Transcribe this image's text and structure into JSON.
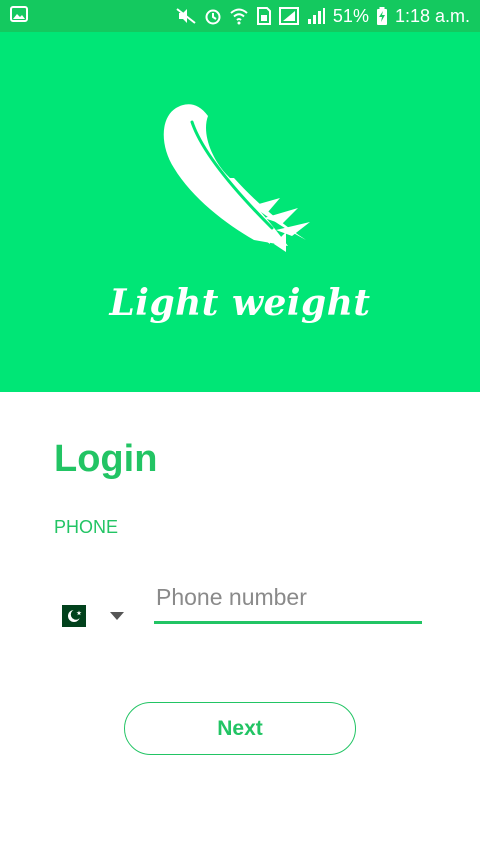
{
  "status_bar": {
    "battery": "51%",
    "time": "1:18 a.m.",
    "icons": [
      "gallery-icon",
      "mute-icon",
      "alarm-icon",
      "wifi-icon",
      "sim-icon",
      "signal-icon",
      "battery-charging-icon"
    ]
  },
  "hero": {
    "brand": "Light weight",
    "logo_icon": "feather-icon"
  },
  "login": {
    "title": "Login",
    "phone_label": "PHONE",
    "phone_placeholder": "Phone number",
    "phone_value": "",
    "next_label": "Next",
    "country_flag": "pakistan-flag-icon"
  },
  "colors": {
    "hero": "#00e676",
    "status_bar": "#14c95f",
    "accent": "#22c464"
  }
}
